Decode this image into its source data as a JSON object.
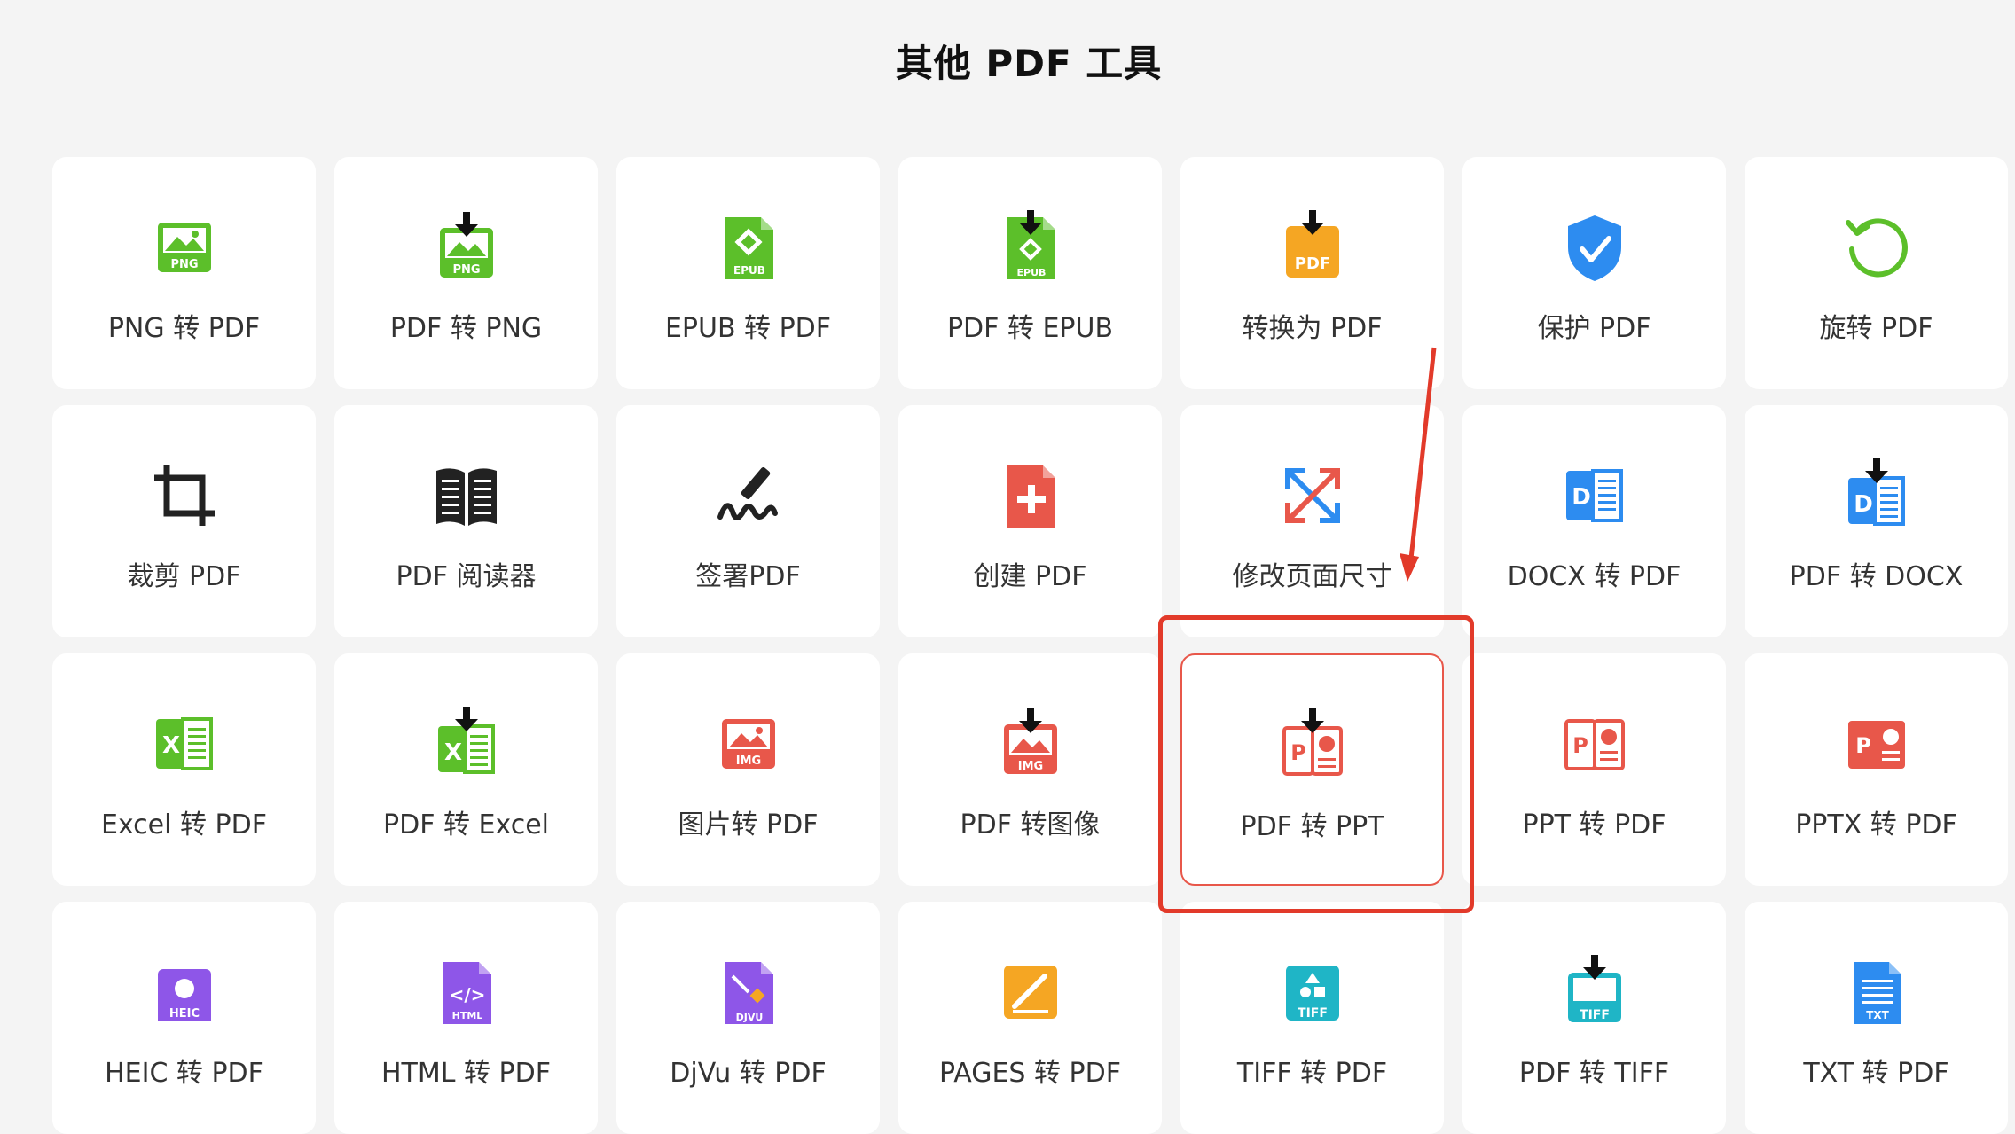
{
  "page": {
    "title": "其他 PDF 工具"
  },
  "colors": {
    "green": "#5cbf2a",
    "orange": "#f5a623",
    "blue": "#2d8cf0",
    "red": "#e8574a",
    "purple": "#8e56e8",
    "teal": "#1fb5c6",
    "dark": "#222222",
    "highlight": "#e23a2a"
  },
  "tools": [
    {
      "label": "PNG 转 PDF",
      "icon": "png-icon"
    },
    {
      "label": "PDF 转 PNG",
      "icon": "pdf-to-png-icon"
    },
    {
      "label": "EPUB 转 PDF",
      "icon": "epub-icon"
    },
    {
      "label": "PDF 转 EPUB",
      "icon": "pdf-to-epub-icon"
    },
    {
      "label": "转换为 PDF",
      "icon": "convert-to-pdf-icon"
    },
    {
      "label": "保护 PDF",
      "icon": "shield-icon"
    },
    {
      "label": "旋转 PDF",
      "icon": "rotate-icon"
    },
    {
      "label": "裁剪 PDF",
      "icon": "crop-icon"
    },
    {
      "label": "PDF 阅读器",
      "icon": "book-icon"
    },
    {
      "label": "签署PDF",
      "icon": "signature-icon"
    },
    {
      "label": "创建 PDF",
      "icon": "create-pdf-icon"
    },
    {
      "label": "修改页面尺寸",
      "icon": "resize-icon"
    },
    {
      "label": "DOCX 转 PDF",
      "icon": "docx-icon"
    },
    {
      "label": "PDF 转 DOCX",
      "icon": "pdf-to-docx-icon"
    },
    {
      "label": "Excel 转 PDF",
      "icon": "excel-icon"
    },
    {
      "label": "PDF 转 Excel",
      "icon": "pdf-to-excel-icon"
    },
    {
      "label": "图片转 PDF",
      "icon": "image-icon"
    },
    {
      "label": "PDF 转图像",
      "icon": "pdf-to-image-icon"
    },
    {
      "label": "PDF 转 PPT",
      "icon": "pdf-to-ppt-icon"
    },
    {
      "label": "PPT 转 PDF",
      "icon": "ppt-icon"
    },
    {
      "label": "PPTX 转 PDF",
      "icon": "pptx-icon"
    },
    {
      "label": "HEIC 转 PDF",
      "icon": "heic-icon"
    },
    {
      "label": "HTML 转 PDF",
      "icon": "html-icon"
    },
    {
      "label": "DjVu 转 PDF",
      "icon": "djvu-icon"
    },
    {
      "label": "PAGES 转 PDF",
      "icon": "pages-icon"
    },
    {
      "label": "TIFF 转 PDF",
      "icon": "tiff-icon"
    },
    {
      "label": "PDF 转 TIFF",
      "icon": "pdf-to-tiff-icon"
    },
    {
      "label": "TXT 转 PDF",
      "icon": "txt-icon"
    }
  ],
  "icon_text": {
    "png": "PNG",
    "pdf": "PDF",
    "epub": "EPUB",
    "img": "IMG",
    "heic": "HEIC",
    "html": "HTML",
    "djvu": "DJVU",
    "tiff": "TIFF",
    "txt": "TXT",
    "d": "D",
    "p": "P",
    "x": "X"
  },
  "selected_index": 18
}
